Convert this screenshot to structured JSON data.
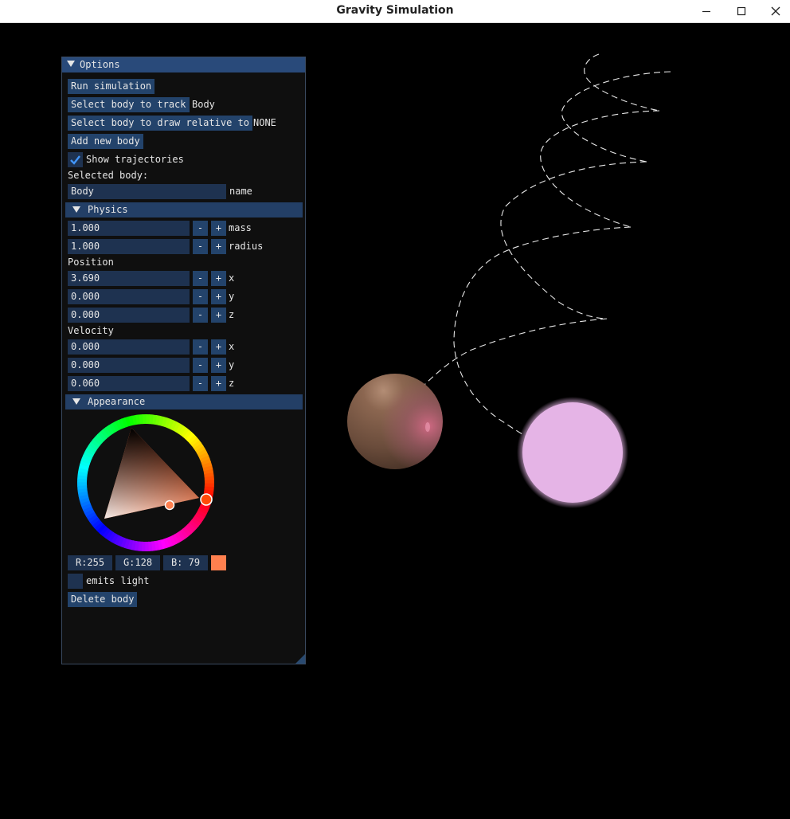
{
  "window": {
    "title": "Gravity Simulation"
  },
  "panel": {
    "title": "Options",
    "run_label": "Run simulation",
    "track_label": "Select body to track",
    "track_value": "Body",
    "relative_label": "Select body to draw relative to",
    "relative_value": "NONE",
    "add_label": "Add new body",
    "show_traj_label": "Show trajectories",
    "show_traj_checked": true,
    "selected_label": "Selected body:",
    "name_value": "Body",
    "name_label": "name",
    "physics": {
      "title": "Physics",
      "mass": {
        "value": "1.000",
        "label": "mass"
      },
      "radius": {
        "value": "1.000",
        "label": "radius"
      },
      "position_label": "Position",
      "position": [
        {
          "value": "3.690",
          "label": "x"
        },
        {
          "value": "0.000",
          "label": "y"
        },
        {
          "value": "0.000",
          "label": "z"
        }
      ],
      "velocity_label": "Velocity",
      "velocity": [
        {
          "value": "0.000",
          "label": "x"
        },
        {
          "value": "0.000",
          "label": "y"
        },
        {
          "value": "0.060",
          "label": "z"
        }
      ],
      "minus": "-",
      "plus": "+"
    },
    "appearance": {
      "title": "Appearance",
      "r": "R:255",
      "g": "G:128",
      "b": "B: 79",
      "swatch_color": "#ff804f",
      "emits_light_label": "emits light",
      "emits_light_checked": false,
      "delete_label": "Delete body"
    }
  },
  "colors": {
    "accent": "#294a7a",
    "button": "#23436b",
    "field": "#1e3250",
    "planet": "#7a5a48",
    "star": "#e5b4e6"
  }
}
